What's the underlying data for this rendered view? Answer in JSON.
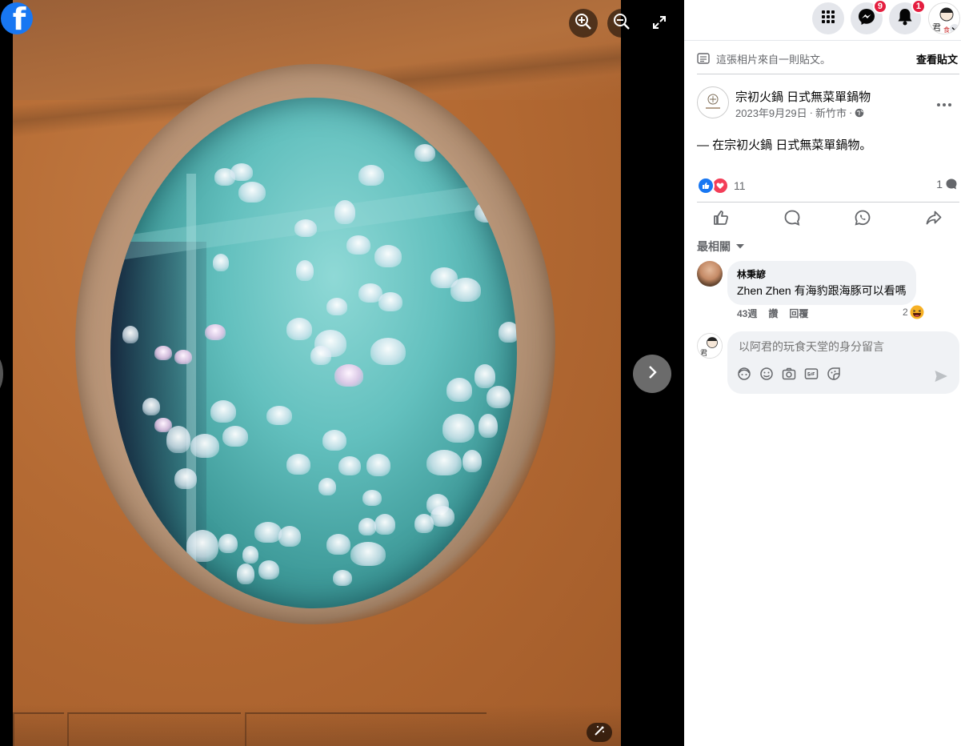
{
  "viewer": {
    "logo_letter": "f",
    "buttons": {
      "zoom_in": "zoom-in-icon",
      "zoom_out": "zoom-out-icon",
      "fullscreen": "fullscreen-icon",
      "next": "chevron-right-icon",
      "magic": "magic-wand-icon"
    },
    "photo_description_colors": {
      "wall": "#b46a33",
      "water": "#63c0be"
    }
  },
  "topbar": {
    "messenger_badge": "9",
    "notifications_badge": "1",
    "icons": [
      "grid-menu-icon",
      "messenger-icon",
      "bell-icon",
      "avatar"
    ]
  },
  "post": {
    "from_post_text": "這張相片來自一則貼文。",
    "view_post_label": "查看貼文",
    "page_name": "宗初火鍋 日式無菜單鍋物",
    "date": "2023年9月29日",
    "location": "新竹市",
    "body": "— 在宗初火鍋 日式無菜單鍋物。",
    "reaction_count": "11",
    "comment_count": "1"
  },
  "comments": {
    "sort_label": "最相關",
    "items": [
      {
        "author": "林秉諺",
        "text": "Zhen Zhen 有海豹跟海豚可以看嗎",
        "time": "43週",
        "like_label": "讚",
        "reply_label": "回覆",
        "reaction_count": "2"
      }
    ],
    "composer_placeholder": "以阿君的玩食天堂的身分留言"
  },
  "colors": {
    "facebook_blue": "#1877f2",
    "badge_red": "#e41e3f",
    "secondary_text": "#65676b",
    "bubble_bg": "#f0f2f5"
  }
}
